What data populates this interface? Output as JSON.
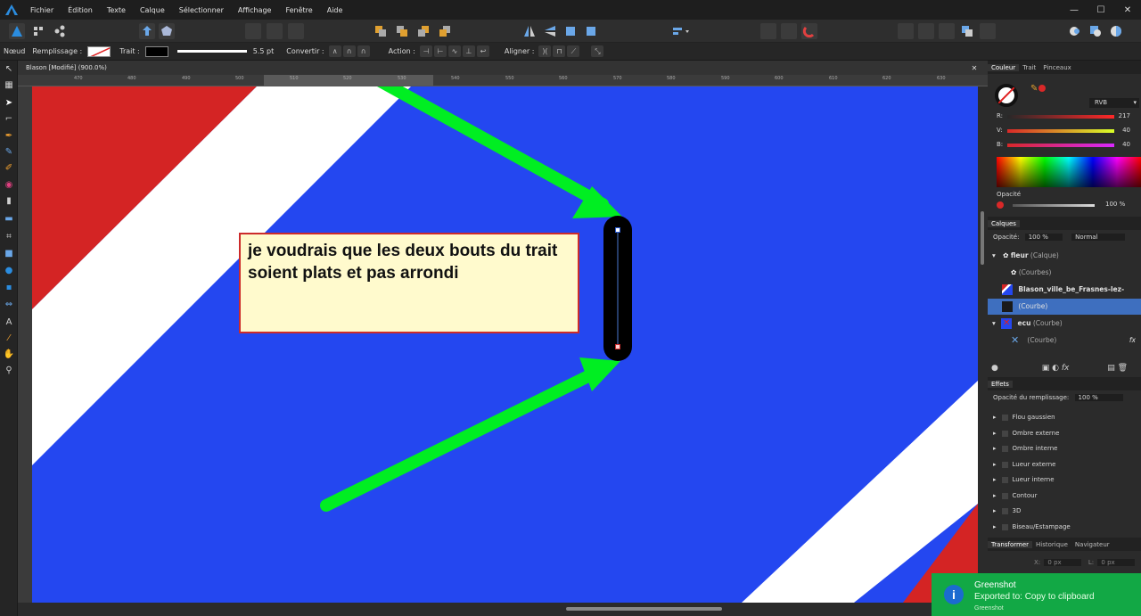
{
  "menu": [
    "Fichier",
    "Édition",
    "Texte",
    "Calque",
    "Sélectionner",
    "Affichage",
    "Fenêtre",
    "Aide"
  ],
  "context_bar": {
    "mode": "Nœud",
    "fill_label": "Remplissage :",
    "stroke_label": "Trait :",
    "stroke_width": "5.5 pt",
    "convert_label": "Convertir :",
    "action_label": "Action :",
    "align_label": "Aligner :"
  },
  "document": {
    "title": "Blason [Modifié] (900.0%)",
    "ruler_ticks": [
      "470",
      "480",
      "490",
      "500",
      "510",
      "520",
      "530",
      "540",
      "550",
      "560",
      "570",
      "580",
      "590",
      "600",
      "610",
      "620",
      "630"
    ]
  },
  "annotation": {
    "text": "je voudrais que les deux bouts du trait soient plats et pas arrondi"
  },
  "color_panel": {
    "tabs": [
      "Couleur",
      "Trait",
      "Pinceaux"
    ],
    "model": "RVB",
    "r_label": "R:",
    "r_value": "217",
    "g_label": "V:",
    "g_value": "40",
    "b_label": "B:",
    "b_value": "40",
    "opacity_label": "Opacité",
    "opacity_value": "100 %",
    "accent": "#d92828"
  },
  "layers_panel": {
    "title": "Calques",
    "opacity_label": "Opacité:",
    "opacity_value": "100 %",
    "blend_mode": "Normal",
    "rows": [
      {
        "name": "fleur",
        "type": "(Calque)"
      },
      {
        "name": "",
        "type": "(Courbes)"
      },
      {
        "name": "Blason_ville_be_Frasnes-lez-Anv...",
        "type": ""
      },
      {
        "name": "",
        "type": "(Courbe)"
      },
      {
        "name": "ecu",
        "type": "(Courbe)"
      },
      {
        "name": "",
        "type": "(Courbe)"
      }
    ]
  },
  "effects_panel": {
    "title": "Effets",
    "fill_opacity_label": "Opacité du remplissage:",
    "fill_opacity_value": "100 %",
    "items": [
      "Flou gaussien",
      "Ombre externe",
      "Ombre interne",
      "Lueur externe",
      "Lueur interne",
      "Contour",
      "3D",
      "Biseau/Estampage"
    ]
  },
  "transform_panel": {
    "tabs": [
      "Transformer",
      "Historique",
      "Navigateur"
    ],
    "x_label": "X:",
    "x_value": "0 px",
    "l_label": "L:",
    "l_value": "0 px"
  },
  "toast": {
    "app": "Greenshot",
    "message": "Exported to: Copy to clipboard",
    "footer": "Greenshot"
  },
  "colors": {
    "canvas_blue": "#2447f0",
    "flag_red": "#d42424",
    "arrow_green": "#00ee22",
    "selection_blue": "#3e6fbf"
  }
}
